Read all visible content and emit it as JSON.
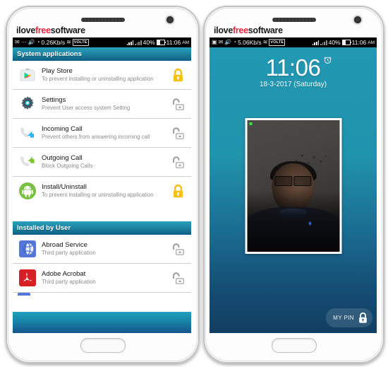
{
  "watermark": {
    "part1": "ilove",
    "part2": "free",
    "part3": "software"
  },
  "colors": {
    "locked": "#f5c116",
    "unlocked": "#9a9a9a",
    "header_teal": "#1b7f9c",
    "lockscreen_top": "#2398b2",
    "lockscreen_bottom": "#123f63",
    "watermark_red": "#e8243c"
  },
  "left_phone": {
    "status_bar": {
      "icons_left": [
        "mail-icon",
        "more-icon",
        "sound-icon",
        "clock-icon"
      ],
      "data_rate": "0.26Kb/s",
      "wifi": "wifi-icon",
      "volte": "VOLTE",
      "sim1_signal": "signal-bars-icon",
      "sim2_signal": "signal-bars-icon",
      "battery_percent": "40%",
      "battery": "battery-icon",
      "time": "11:06",
      "meridiem": "AM"
    },
    "sections": [
      {
        "title": "System applications",
        "apps": [
          {
            "name": "Play Store",
            "desc": "To prevent installing or uninstalling application",
            "icon": "play-store-icon",
            "locked": true
          },
          {
            "name": "Settings",
            "desc": "Prevent User access system Setting",
            "icon": "settings-gear-icon",
            "locked": false
          },
          {
            "name": "Incoming Call",
            "desc": "Prevent others from answering incoming call",
            "icon": "incoming-call-icon",
            "locked": false
          },
          {
            "name": "Outgoing Call",
            "desc": "Block Outgoing Calls",
            "icon": "outgoing-call-icon",
            "locked": false
          },
          {
            "name": "Install/Uninstall",
            "desc": "To prevent installing or uninstalling application",
            "icon": "android-install-icon",
            "locked": true
          }
        ]
      },
      {
        "title": "Installed by User",
        "apps": [
          {
            "name": "Abroad Service",
            "desc": "Third party application",
            "icon": "globe-app-icon",
            "locked": false
          },
          {
            "name": "Adobe Acrobat",
            "desc": "Third party application",
            "icon": "adobe-acrobat-icon",
            "locked": false
          }
        ]
      }
    ]
  },
  "right_phone": {
    "status_bar": {
      "icons_left": [
        "sim-icon",
        "mail-icon",
        "sound-icon",
        "clock-icon"
      ],
      "data_rate": "5.06Kb/s",
      "wifi": "wifi-icon",
      "volte": "VOLTE",
      "battery_percent": "40%",
      "time": "11:06",
      "meridiem": "AM"
    },
    "lock_screen": {
      "time": "11:06",
      "alarm_icon": "alarm-clock-icon",
      "date": "18-3-2017  (Saturday)",
      "intruder_photo": {
        "recording_indicator": "recording-dot-icon",
        "caption": "intruder-selfie-photo"
      },
      "pin_button": {
        "label": "MY PIN",
        "icon": "padlock-icon"
      }
    }
  }
}
